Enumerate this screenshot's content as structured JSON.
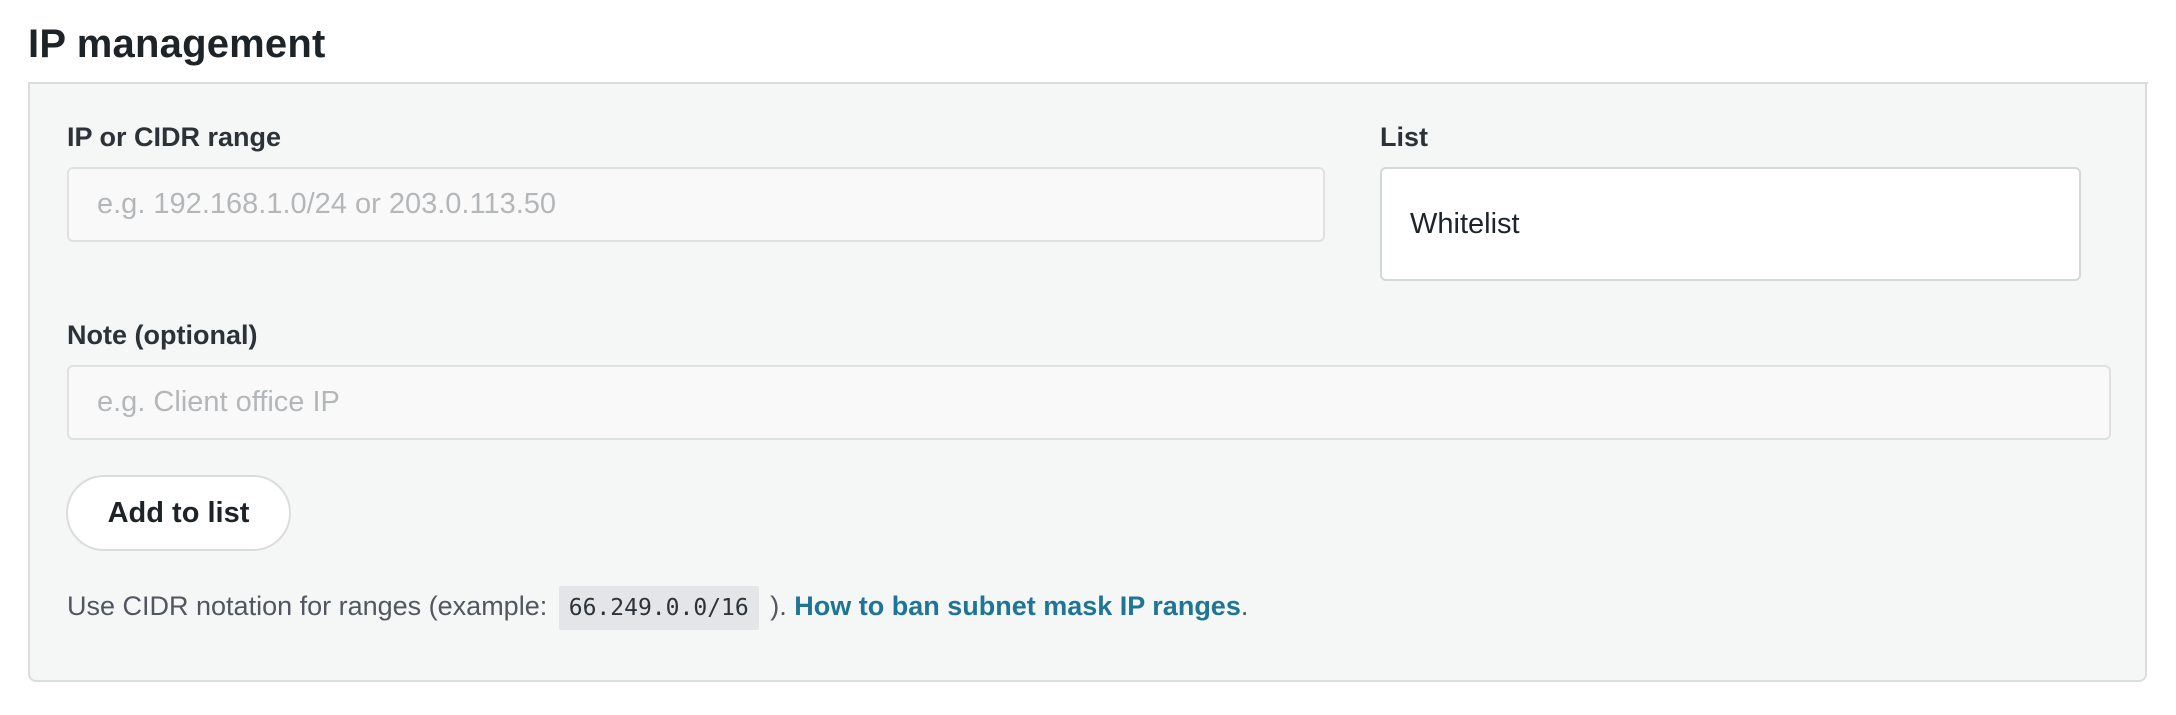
{
  "page": {
    "title": "IP management"
  },
  "form": {
    "ip_field": {
      "label": "IP or CIDR range",
      "value": "",
      "placeholder": "e.g. 192.168.1.0/24 or 203.0.113.50"
    },
    "list_field": {
      "label": "List",
      "selected": "Whitelist"
    },
    "note_field": {
      "label": "Note (optional)",
      "value": "",
      "placeholder": "e.g. Client office IP"
    },
    "submit_label": "Add to list"
  },
  "help": {
    "prefix": "Use CIDR notation for ranges (example: ",
    "code": "66.249.0.0/16",
    "middle": " ). ",
    "link_text": "How to ban subnet mask IP ranges",
    "suffix": "."
  },
  "colors": {
    "link": "#1f7594",
    "panel_bg": "#f5f6f6",
    "border": "#dcdcde"
  }
}
